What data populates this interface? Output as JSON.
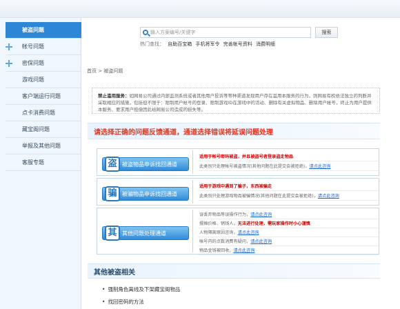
{
  "sidebar": {
    "items": [
      {
        "label": "被盗问题",
        "active": true
      },
      {
        "label": "帐号问题",
        "plus": true
      },
      {
        "label": "密保问题",
        "plus": true
      },
      {
        "label": "游戏问题"
      },
      {
        "label": "客户端运行问题"
      },
      {
        "label": "点卡消费问题"
      },
      {
        "label": "藏宝阁问题"
      },
      {
        "label": "举报及其他问题"
      },
      {
        "label": "客服专题"
      }
    ]
  },
  "search": {
    "placeholder": "输入方案编号/关键字",
    "button": "搜索",
    "hot_label": "热门查找：",
    "hot_links": [
      "自助百宝箱",
      "手机将军令",
      "完善帐号资料",
      "消费明细"
    ]
  },
  "breadcrumb": "首页 > 被盗问题",
  "notice": {
    "title": "禁止滥用服务：",
    "text": "如网易公司通过内部监测系统或者其他用户投诉等等种渠道发现用户存在滥用本服务的行为，则网易有权依法独立的判断并采取相应的措施，包括但不限于：限制用户帐号的登录、限制游戏ID在游戏中的活动、删除有关虚拟物品、删除用户帐号，终止为用户提供本服务、要求用户赔偿因此给网易公司造成的损失等。"
  },
  "headline": {
    "prefix": "请选择正确的问题反馈通道，通道选择错误将",
    "highlight": "延误问题处理"
  },
  "channels": [
    {
      "badge": "盗",
      "label": "被盗物品申诉找回通道",
      "lines": [
        {
          "red": "适用于帐号密码被盗，并且被盗号者登录盗走物品"
        },
        {
          "text": "此类别只处理帐号被盗情况(其他问题在此提交会被拒绝)，",
          "link": "请点此咨询"
        }
      ]
    },
    {
      "badge": "骗",
      "label": "被骗物品申诉找回通道",
      "lines": [
        {
          "red": "适用于游戏中遇到了骗子，东西被骗走"
        },
        {
          "text": "此类别只处理游戏物品被骗情况(其他问题在此提交会被拒绝)，",
          "link": "请点此咨询"
        }
      ]
    },
    {
      "badge": "其",
      "label": "其他问题处理通道",
      "lines": [
        {
          "text": "误丢弃物品等误操作行为，",
          "link": "请点此咨询"
        },
        {
          "text": "摆摊价格、销钱人，",
          "red": "无法进行处理，需玩家操作时小心谨慎"
        },
        {
          "text": "人物隔离原因咨询，",
          "link": "请点此咨询"
        },
        {
          "text": "帐号内的点数消费有疑问，",
          "link": "请点此咨询"
        },
        {
          "text": "物品金钱被回收，",
          "link": "请点此咨询"
        }
      ]
    }
  ],
  "other": {
    "title": "其他被盗相关",
    "links": [
      "强制角色离线及下架藏宝阁物品",
      "找回密码的方法"
    ]
  }
}
